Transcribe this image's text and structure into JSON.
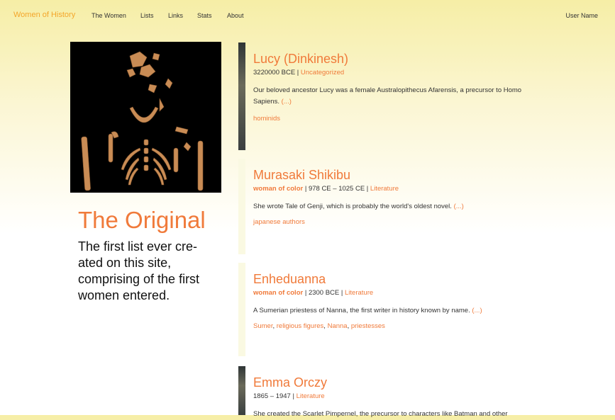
{
  "nav": {
    "brand": "Women of History",
    "links": [
      "The Women",
      "Lists",
      "Links",
      "Stats",
      "About"
    ],
    "user": "User Name"
  },
  "list": {
    "title": "The Original",
    "description": "The first list ever cre-ated on this site, comprising of the first women entered."
  },
  "entries": [
    {
      "name": "Lucy (Dinkinesh)",
      "tag": "",
      "dates": "3220000 BCE | ",
      "category": "Uncategorized",
      "summary": "Our beloved ancestor Lucy was a female Australopithecus Afarensis, a precursor to Homo Sapiens.",
      "more": "(...)",
      "tags": [
        "hominids"
      ]
    },
    {
      "name": "Murasaki Shikibu",
      "tag": "woman of color",
      "dates": " | 978 CE – 1025 CE | ",
      "category": "Literature",
      "summary": "She wrote Tale of Genji, which is probably the world's oldest novel.",
      "more": "(...)",
      "tags": [
        "japanese authors"
      ]
    },
    {
      "name": "Enheduanna",
      "tag": "woman of color",
      "dates": " | 2300 BCE | ",
      "category": "Literature",
      "summary": "A Sumerian priestess of Nanna, the first writer in history known by name.",
      "more": "(...)",
      "tags": [
        "Sumer",
        "religious figures",
        "Nanna",
        "priestesses"
      ]
    },
    {
      "name": "Emma Orczy",
      "tag": "",
      "dates": "1865 – 1947 | ",
      "category": "Literature",
      "summary": "She created the Scarlet Pimpernel, the precursor to characters like Batman and other",
      "more": "",
      "tags": []
    }
  ]
}
